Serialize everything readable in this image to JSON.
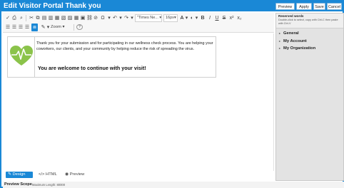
{
  "window": {
    "title": "Edit Visitor Portal Thank you"
  },
  "title_buttons": {
    "preview": "Preview",
    "apply": "Apply",
    "save": "Save",
    "cancel": "Cancel"
  },
  "toolbar": {
    "font_family": "\"Times Ne...",
    "font_size": "16px",
    "zoom_label": "Zoom",
    "help_glyph": "?"
  },
  "content": {
    "message": "Thank you for your submission and for participating in our wellness check process. You are helping your coworkers, our clients, and your community by helping reduce the risk of spreading the virus.",
    "welcome": "You are welcome to continue with your visit!",
    "heart_color": "#8bc34a"
  },
  "modes": {
    "design": "Design",
    "html": "HTML",
    "preview": "Preview"
  },
  "footer": {
    "label": "Preview Scope",
    "max_length": "Maximum Length: 80000"
  },
  "sidebar": {
    "title": "Reserved words",
    "hint": "Double-click to select, copy with Ctrl-C then paste with Ctrl-V",
    "items": [
      "General",
      "My Account",
      "My Organization"
    ]
  },
  "colors": {
    "accent": "#1a88d6"
  }
}
